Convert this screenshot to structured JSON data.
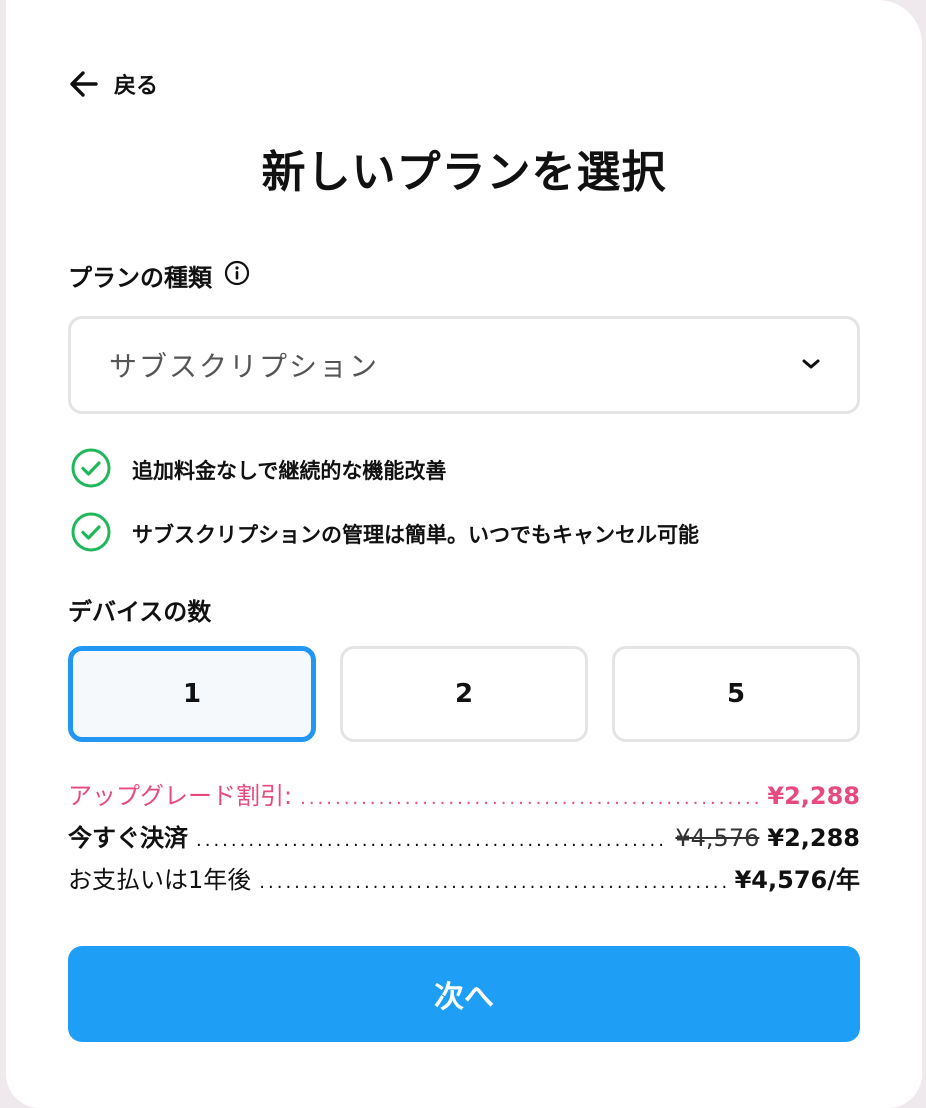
{
  "back": {
    "label": "戻る"
  },
  "title": "新しいプランを選択",
  "plan_type": {
    "label": "プランの種類",
    "selected": "サブスクリプション"
  },
  "features": [
    "追加料金なしで継続的な機能改善",
    "サブスクリプションの管理は簡単。いつでもキャンセル可能"
  ],
  "devices": {
    "label": "デバイスの数",
    "options": [
      "1",
      "2",
      "5"
    ],
    "selected": "1"
  },
  "pricing": {
    "discount_label": "アップグレード割引:",
    "discount_value": "¥2,288",
    "pay_now_label": "今すぐ決済",
    "pay_now_original": "¥4,576",
    "pay_now_value": "¥2,288",
    "renewal_label": "お支払いは1年後",
    "renewal_value": "¥4,576/年"
  },
  "next_button": "次へ",
  "colors": {
    "accent": "#1e9ef5",
    "discount": "#e84a7f",
    "check": "#1fb85a"
  }
}
